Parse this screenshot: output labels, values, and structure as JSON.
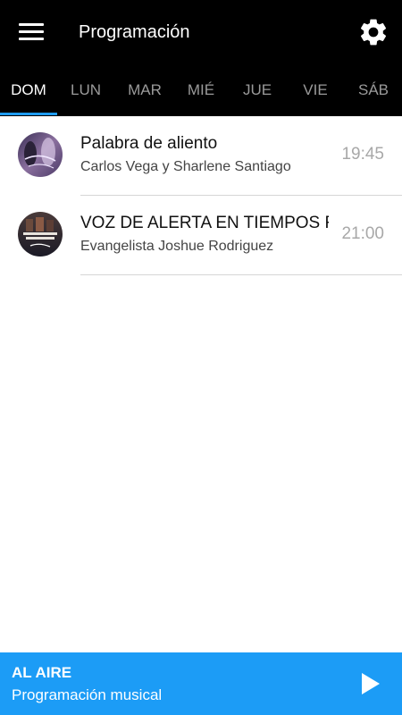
{
  "appbar": {
    "title": "Programación",
    "menu_icon": "hamburger-menu-icon",
    "settings_icon": "gear-icon"
  },
  "tabs": [
    {
      "label": "DOM",
      "active": true
    },
    {
      "label": "LUN",
      "active": false
    },
    {
      "label": "MAR",
      "active": false
    },
    {
      "label": "MIÉ",
      "active": false
    },
    {
      "label": "JUE",
      "active": false
    },
    {
      "label": "VIE",
      "active": false
    },
    {
      "label": "SÁB",
      "active": false
    }
  ],
  "programs": [
    {
      "title": "Palabra de aliento",
      "hosts": "Carlos Vega y Sharlene Santiago",
      "time": "19:45",
      "thumbnail": "palabra-de-aliento-thumbnail"
    },
    {
      "title": "VOZ DE ALERTA EN TIEMPOS F",
      "hosts": "Evangelista Joshue Rodriguez",
      "time": "21:00",
      "thumbnail": "voz-de-alerta-thumbnail"
    }
  ],
  "player": {
    "status": "AL AIRE",
    "now_playing": "Programación musical",
    "play_icon": "play-icon"
  },
  "colors": {
    "appbar": "#000000",
    "accent": "#1c9cf6",
    "tab_inactive": "#9a9a9a"
  }
}
